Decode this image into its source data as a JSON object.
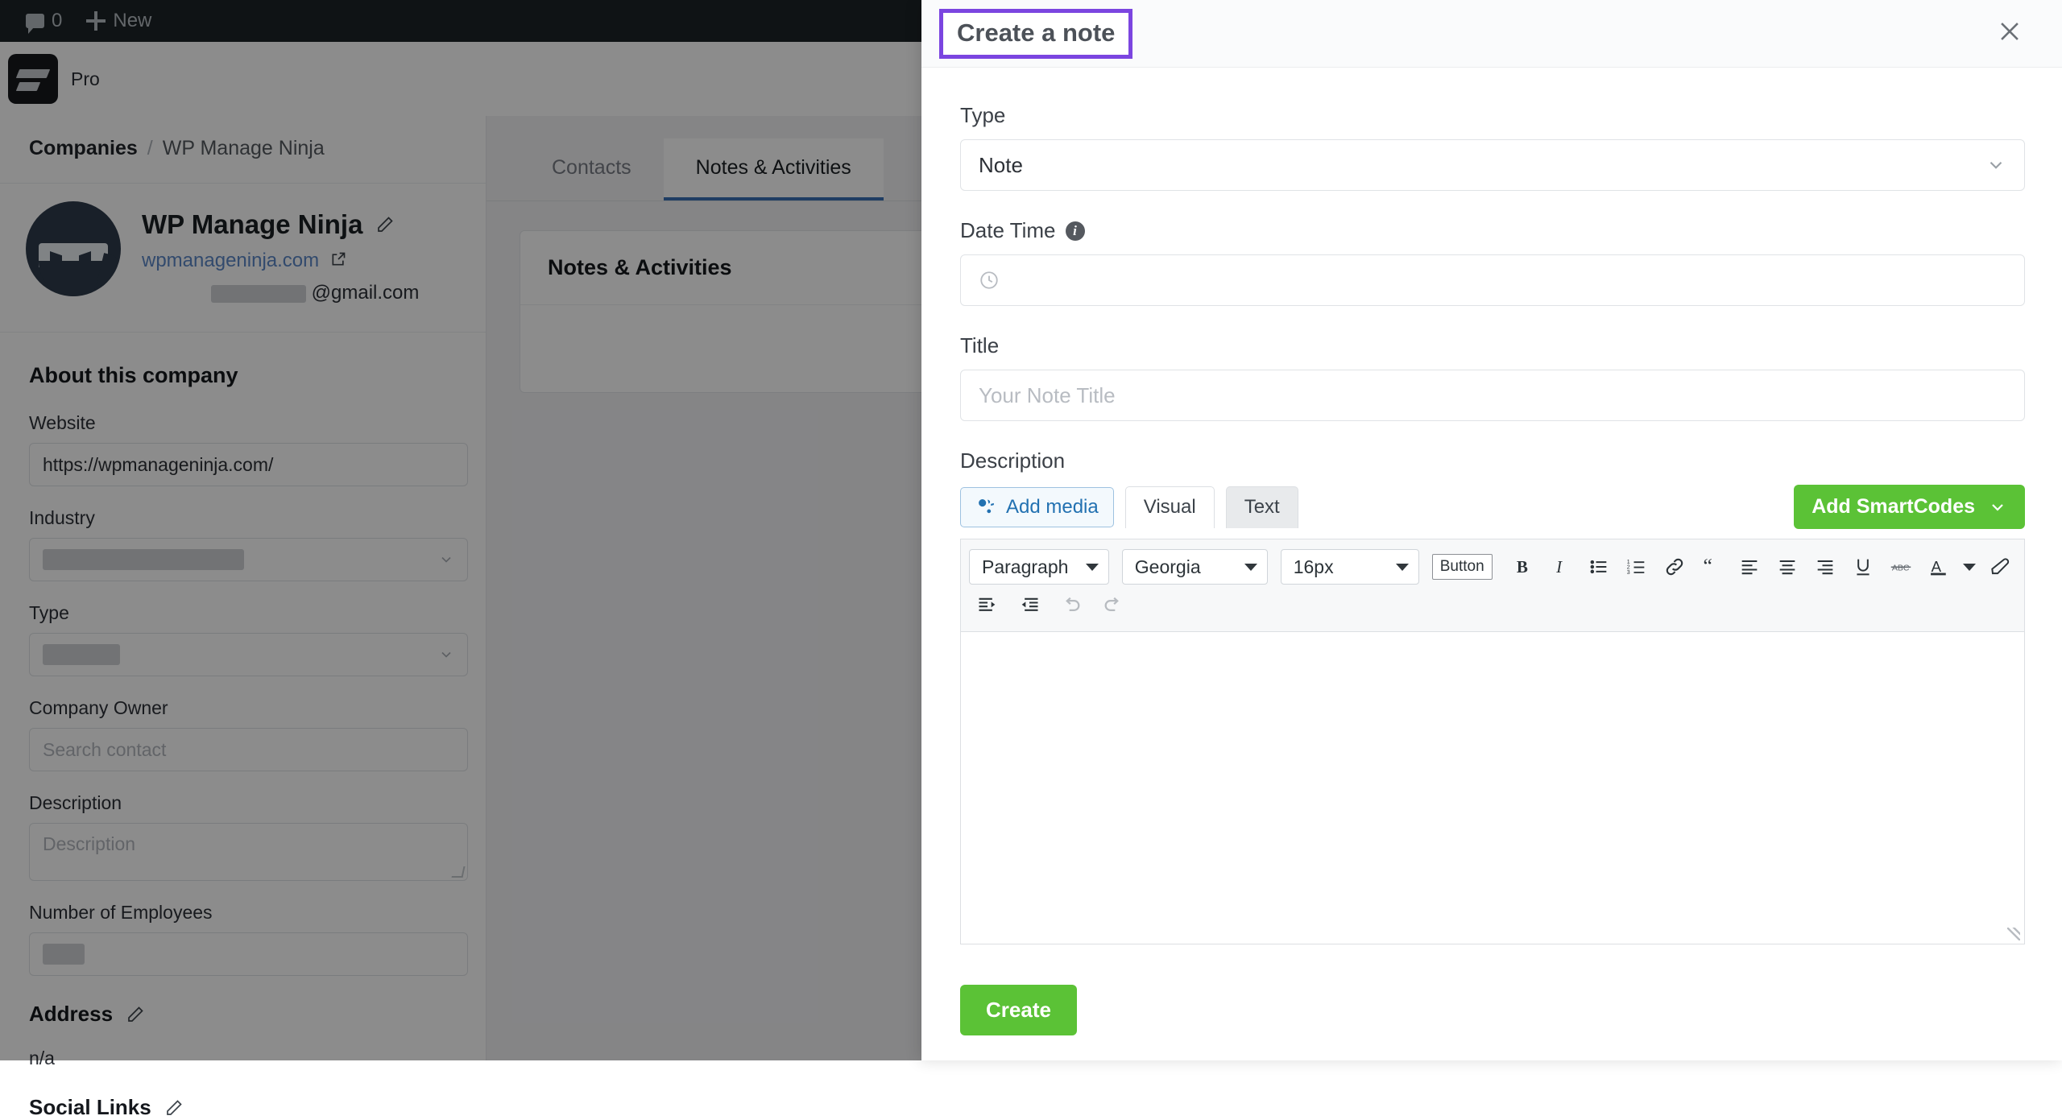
{
  "adminbar": {
    "comment_icon": "comment-icon",
    "comment_count": "0",
    "new_label": "New"
  },
  "brand": {
    "logo_icon": "fluentcrm-logo-icon",
    "name": "Pro"
  },
  "company_panel": {
    "breadcrumb": {
      "root": "Companies",
      "separator": "/",
      "current": "WP Manage Ninja"
    },
    "name": "WP Manage Ninja",
    "edit_icon": "pencil-icon",
    "website_link": "wpmanageninja.com",
    "external_icon": "external-link-icon",
    "email_suffix": "@gmail.com",
    "about_title": "About this company",
    "fields": [
      {
        "label": "Website",
        "value": "https://wpmanageninja.com/",
        "kind": "text"
      },
      {
        "label": "Industry",
        "value": "",
        "kind": "select-redacted"
      },
      {
        "label": "Type",
        "value": "",
        "kind": "select-redacted-short"
      },
      {
        "label": "Company Owner",
        "value": "Search contact",
        "kind": "placeholder"
      },
      {
        "label": "Description",
        "value": "Description",
        "kind": "textarea"
      },
      {
        "label": "Number of Employees",
        "value": "",
        "kind": "text-redacted"
      }
    ],
    "address_title": "Address",
    "address_value": "n/a",
    "social_title": "Social Links"
  },
  "main": {
    "tabs": [
      {
        "label": "Contacts",
        "active": false
      },
      {
        "label": "Notes & Activities",
        "active": true
      }
    ],
    "card_title": "Notes & Activities"
  },
  "drawer": {
    "title": "Create a note",
    "close_icon": "close-icon",
    "highlight_color": "#7b45e0",
    "type": {
      "label": "Type",
      "value": "Note",
      "chevron_icon": "chevron-down-icon"
    },
    "datetime": {
      "label": "Date Time",
      "info_icon": "info-icon",
      "info_glyph": "i",
      "value": "",
      "clock_icon": "clock-icon"
    },
    "title_field": {
      "label": "Title",
      "value": "",
      "placeholder": "Your Note Title"
    },
    "description": {
      "label": "Description",
      "add_media_label": "Add media",
      "add_media_icon": "media-icon",
      "visual_tab": "Visual",
      "text_tab": "Text",
      "smartcodes_label": "Add SmartCodes",
      "smartcodes_icon": "chevron-down-icon",
      "smartcodes_color": "#5bc236",
      "toolbar": {
        "format_select": "Paragraph",
        "font_select": "Georgia",
        "size_select": "16px",
        "button_label": "Button",
        "icons_row1": [
          "bold-icon",
          "italic-icon",
          "bullet-list-icon",
          "numbered-list-icon",
          "link-icon",
          "blockquote-icon",
          "align-left-icon",
          "align-center-icon",
          "align-right-icon",
          "underline-icon",
          "strikethrough-icon",
          "text-color-icon",
          "color-chevron-down-icon",
          "clear-formatting-icon"
        ],
        "icons_row2": [
          "outdent-icon",
          "indent-icon",
          "undo-icon",
          "redo-icon"
        ]
      },
      "body_value": "",
      "resize_icon": "resize-handle-icon"
    },
    "create_label": "Create",
    "create_color": "#5bc236"
  }
}
